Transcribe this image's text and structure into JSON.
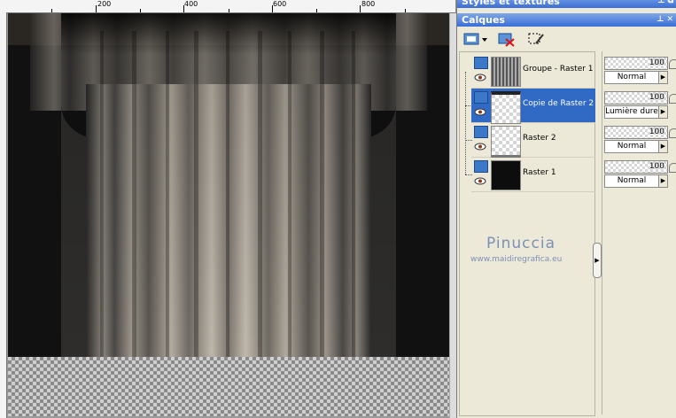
{
  "ruler": {
    "marks": [
      "200",
      "400",
      "600",
      "800"
    ]
  },
  "styles_panel": {
    "title": "Styles et textures"
  },
  "layers_panel": {
    "title": "Calques",
    "layers": [
      {
        "name": "Groupe - Raster 1",
        "opacity": "100",
        "blend": "Normal",
        "selected": false
      },
      {
        "name": "Copie de Raster 2",
        "opacity": "100",
        "blend": "Lumière dure",
        "selected": true
      },
      {
        "name": "Raster 2",
        "opacity": "100",
        "blend": "Normal",
        "selected": false
      },
      {
        "name": "Raster 1",
        "opacity": "100",
        "blend": "Normal",
        "selected": false
      }
    ]
  },
  "watermark": {
    "name": "Pinuccia",
    "url": "www.maidiregrafica.eu"
  },
  "icons": [
    "new-layer-icon",
    "dropdown-arrow-icon",
    "delete-layer-icon",
    "edit-selection-icon",
    "eye-icon",
    "lock-icon",
    "pin-icon",
    "close-icon",
    "collapse-arrow-icon"
  ],
  "colors": {
    "selection": "#316ac5",
    "titlebar": "#3a6ed6",
    "panel": "#ece9d8",
    "watermark": "#7d8fb4"
  }
}
